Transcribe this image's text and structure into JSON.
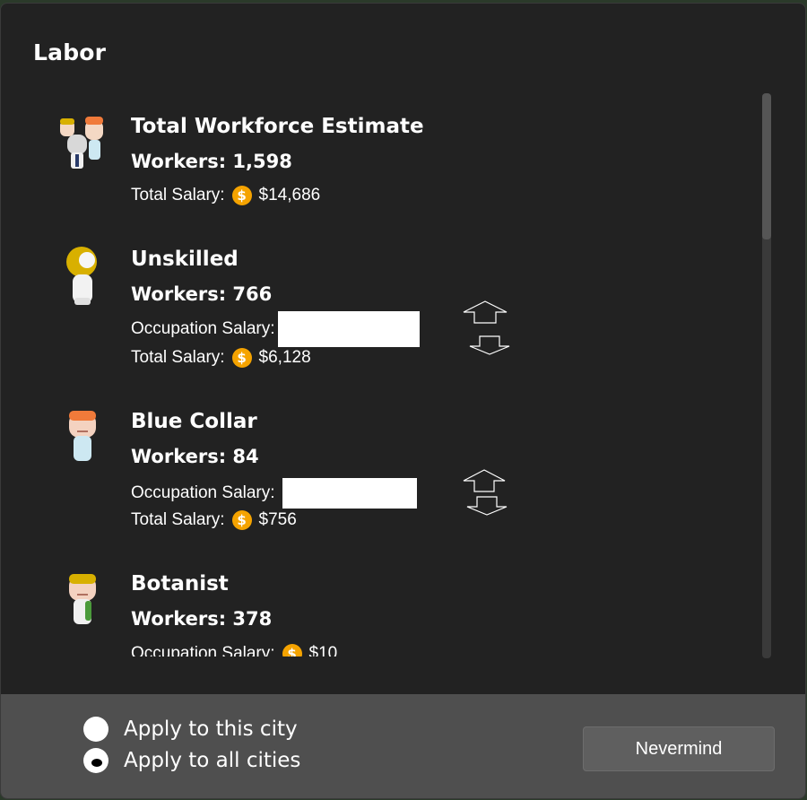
{
  "dialog": {
    "title": "Labor"
  },
  "summary": {
    "name": "Total Workforce Estimate",
    "workers": "Workers: 1,598",
    "total_salary_label": "Total Salary:",
    "total_salary_value": "$14,686"
  },
  "occupations": [
    {
      "name": "Unskilled",
      "workers": "Workers: 766",
      "occupation_salary_label": "Occupation Salary:",
      "occupation_salary_value": "",
      "total_salary_label": "Total Salary:",
      "total_salary_value": "$6,128"
    },
    {
      "name": "Blue Collar",
      "workers": "Workers: 84",
      "occupation_salary_label": "Occupation Salary:",
      "occupation_salary_value": "",
      "total_salary_label": "Total Salary:",
      "total_salary_value": "$756"
    },
    {
      "name": "Botanist",
      "workers": "Workers: 378",
      "occupation_salary_label": "Occupation Salary:",
      "occupation_salary_value": "$10"
    }
  ],
  "footer": {
    "apply_this_city": "Apply to this city",
    "apply_all_cities": "Apply to all cities",
    "selected_option": "Apply to all cities",
    "nevermind_button": "Nevermind"
  },
  "icons": {
    "coin": "coin-icon",
    "increase": "arrow-up-icon",
    "decrease": "arrow-down-icon"
  },
  "colors": {
    "panel": "#222222",
    "footer": "#4f4f4f",
    "coin": "#f5a300",
    "text": "#ffffff"
  }
}
